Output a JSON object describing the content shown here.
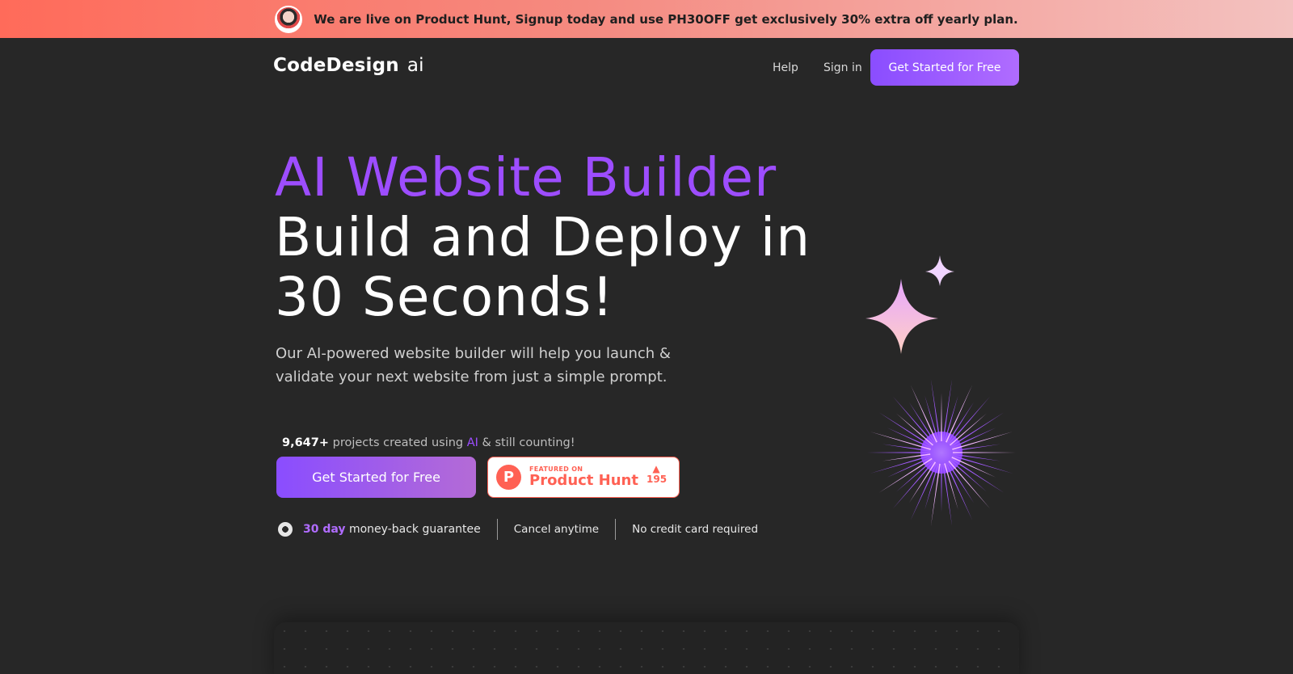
{
  "promo": {
    "text": "We are live on Product Hunt, Signup today and use PH30OFF get exclusively 30% extra off yearly plan."
  },
  "nav": {
    "logo_main": "CodeDesign",
    "logo_suffix": "ai",
    "help": "Help",
    "signin": "Sign in",
    "cta": "Get Started for Free"
  },
  "hero": {
    "title_line1": "AI Website Builder",
    "title_line2": "Build and Deploy in 30 Seconds!",
    "subtitle": "Our AI-powered website builder will help you launch & validate your next website from just a simple prompt.",
    "counter_number": "9,647+",
    "counter_text_before": " projects created using ",
    "counter_highlight": "AI",
    "counter_text_after": " & still counting!",
    "cta": "Get Started for Free"
  },
  "product_hunt": {
    "featured": "FEATURED ON",
    "name": "Product Hunt",
    "logo_letter": "P",
    "votes": "195"
  },
  "guarantees": {
    "days": "30 day",
    "money_back": " money-back guarantee",
    "cancel": "Cancel anytime",
    "no_card": "No credit card required"
  },
  "colors": {
    "accent": "#9d4dff",
    "background": "#272727",
    "product_hunt": "#ff6154"
  }
}
